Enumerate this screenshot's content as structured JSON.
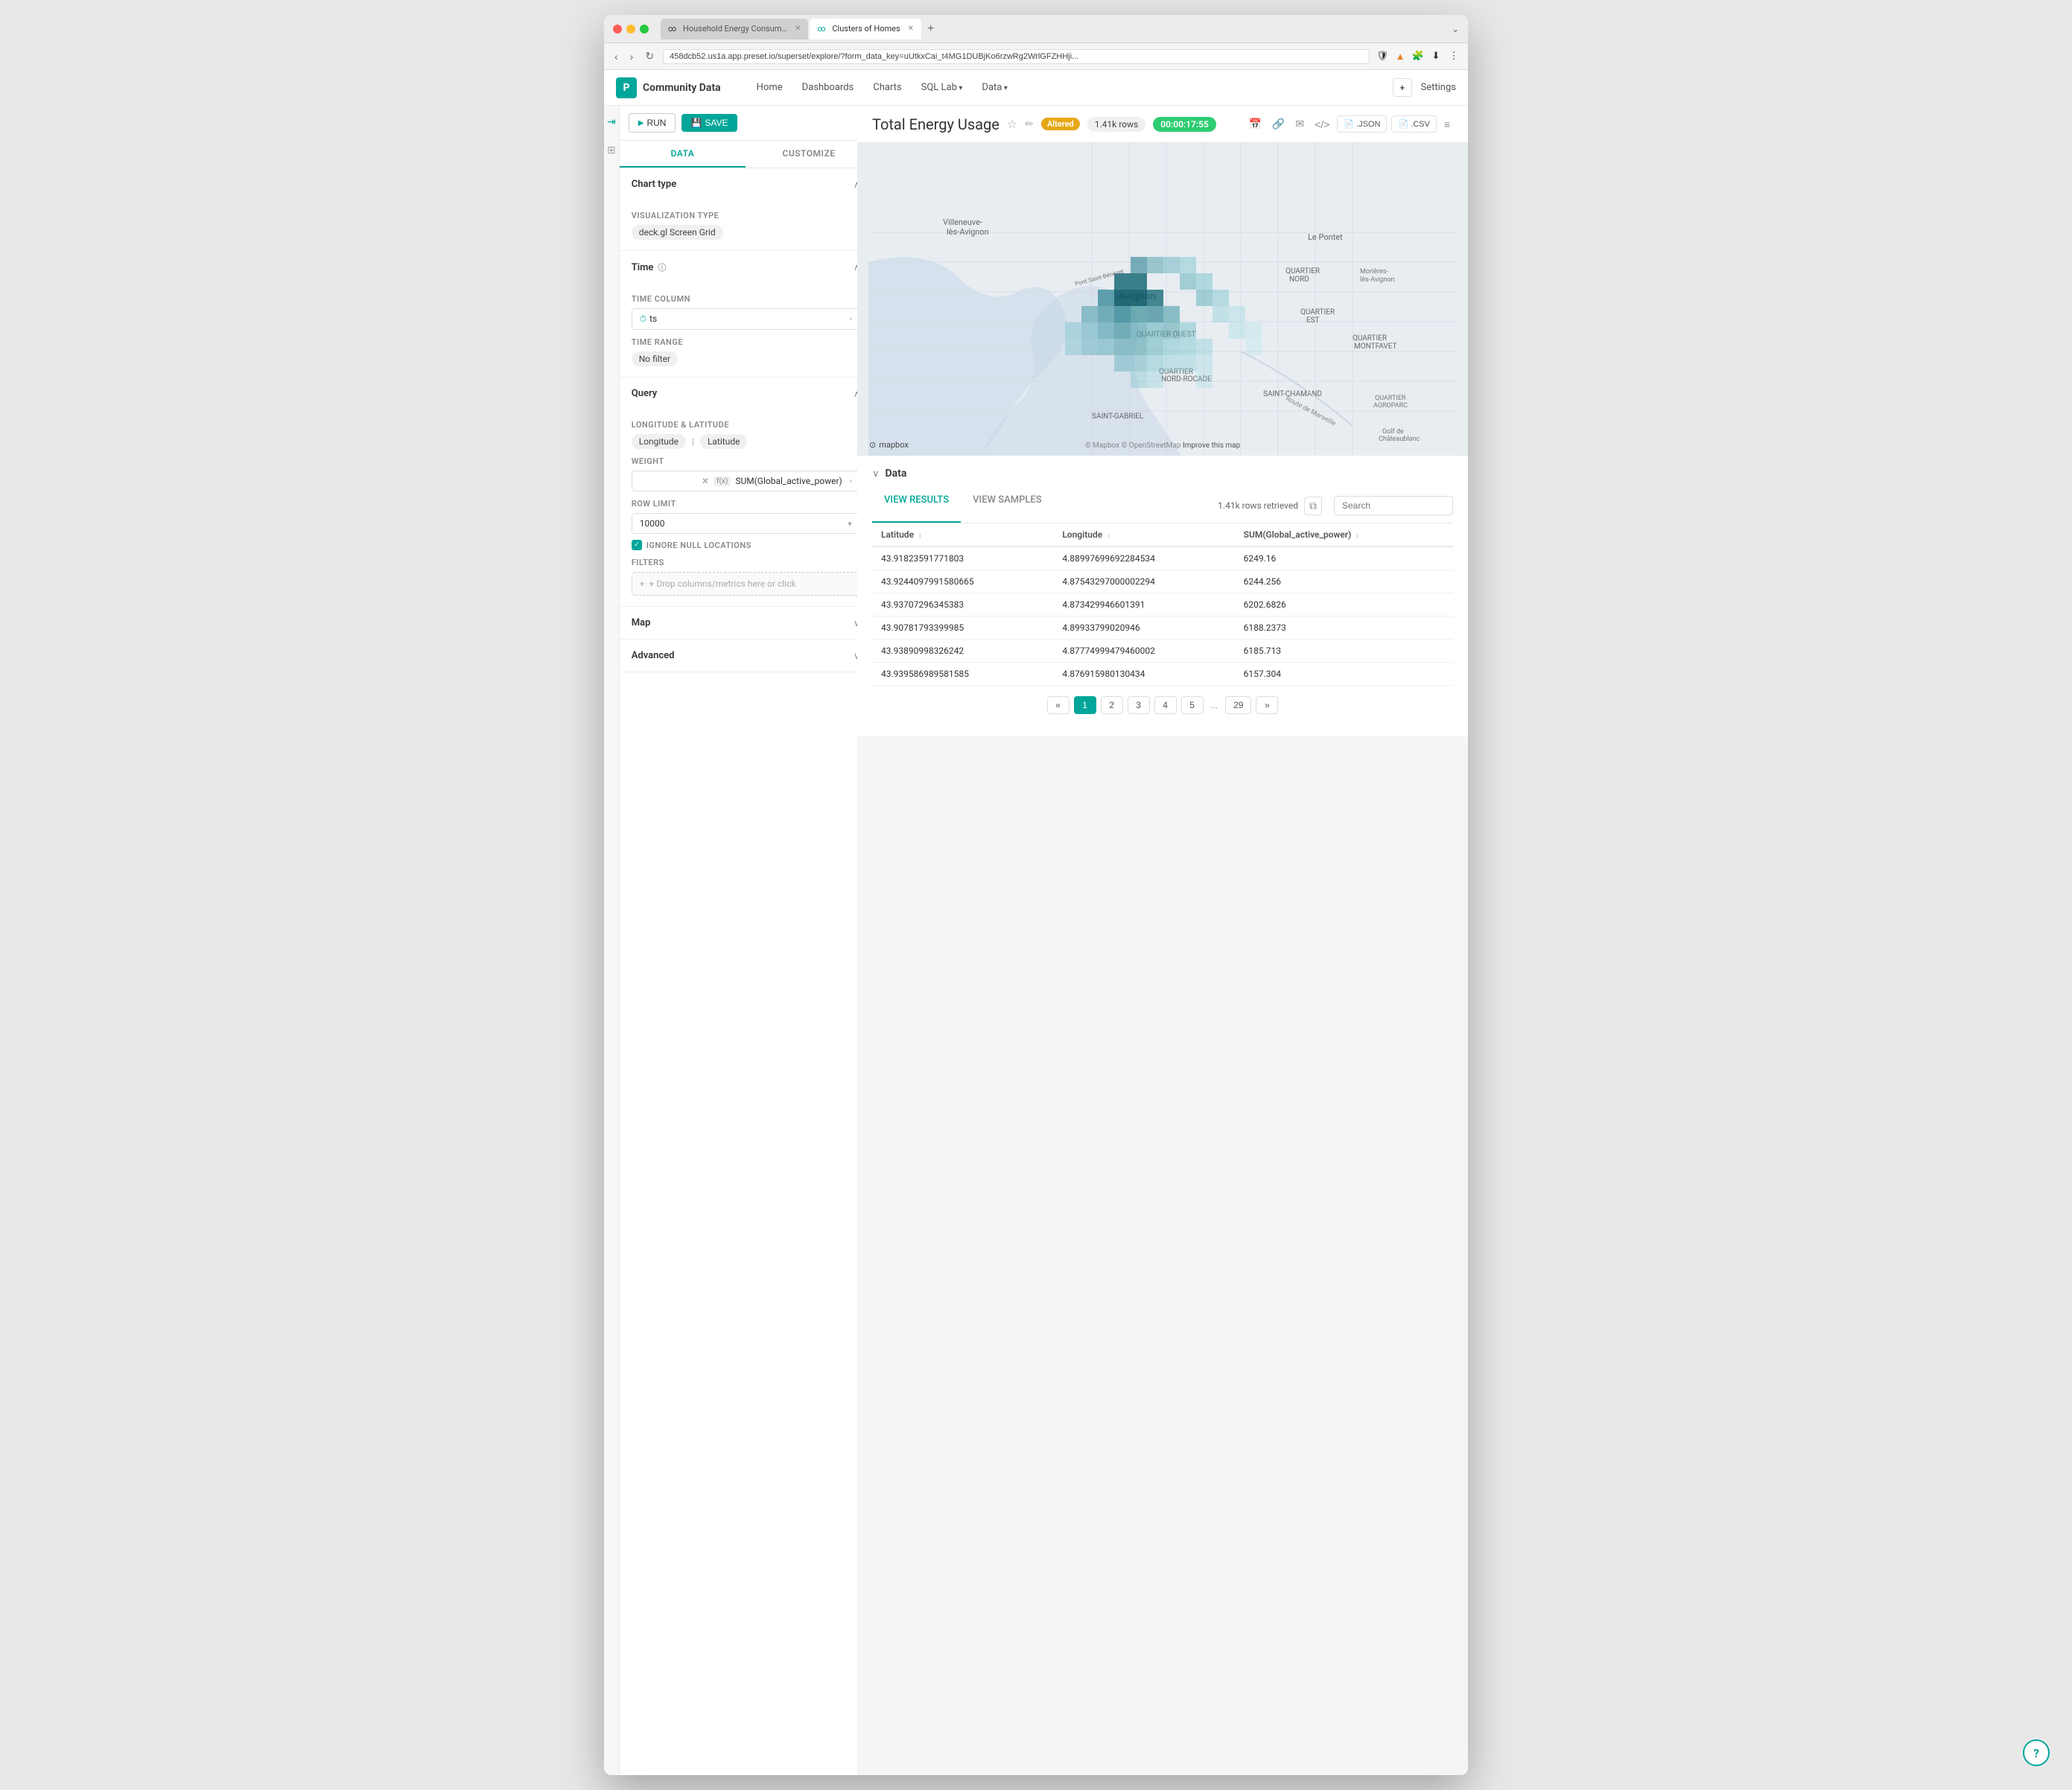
{
  "window": {
    "tabs": [
      {
        "id": "tab1",
        "label": "Household Energy Consumption (F...",
        "icon": "∞",
        "active": false
      },
      {
        "id": "tab2",
        "label": "Clusters of Homes",
        "icon": "∞",
        "active": true
      }
    ],
    "url": "458dcb52.us1a.app.preset.io/superset/explore/?form_data_key=uUtkxCai_t4MG1DUBjKo6rzwRg2WrlGFZHHji..."
  },
  "app": {
    "logo": "P",
    "title": "Community Data",
    "nav": [
      {
        "id": "home",
        "label": "Home"
      },
      {
        "id": "dashboards",
        "label": "Dashboards"
      },
      {
        "id": "charts",
        "label": "Charts"
      },
      {
        "id": "sql_lab",
        "label": "SQL Lab",
        "hasArrow": true
      },
      {
        "id": "data",
        "label": "Data",
        "hasArrow": true
      }
    ],
    "header_right": {
      "plus_label": "+",
      "settings_label": "Settings"
    }
  },
  "sidebar": {
    "run_label": "RUN",
    "save_label": "SAVE",
    "tabs": [
      {
        "id": "data",
        "label": "DATA",
        "active": true
      },
      {
        "id": "customize",
        "label": "CUSTOMIZE",
        "active": false
      }
    ],
    "chart_type": {
      "title": "Chart type",
      "viz_type_label": "VISUALIZATION TYPE",
      "viz_type_value": "deck.gl Screen Grid"
    },
    "time": {
      "title": "Time",
      "time_column_label": "TIME COLUMN",
      "time_column_value": "ts",
      "time_range_label": "TIME RANGE",
      "time_range_value": "No filter"
    },
    "query": {
      "title": "Query",
      "long_lat_label": "LONGITUDE & LATITUDE",
      "longitude": "Longitude",
      "latitude": "Latitude",
      "weight_label": "WEIGHT",
      "weight_value": "SUM(Global_active_power)",
      "row_limit_label": "ROW LIMIT",
      "row_limit_value": "10000",
      "ignore_null_label": "IGNORE NULL LOCATIONS",
      "filters_label": "FILTERS",
      "filters_placeholder": "+ Drop columns/metrics here or click"
    },
    "map": {
      "title": "Map"
    },
    "advanced": {
      "title": "Advanced"
    }
  },
  "chart": {
    "title": "Total Energy Usage",
    "altered_label": "Altered",
    "rows_label": "1.41k rows",
    "time_label": "00:00:17:55",
    "json_label": ".JSON",
    "csv_label": ".CSV"
  },
  "data_panel": {
    "title": "Data",
    "tabs": [
      {
        "id": "view_results",
        "label": "VIEW RESULTS",
        "active": true
      },
      {
        "id": "view_samples",
        "label": "VIEW SAMPLES",
        "active": false
      }
    ],
    "rows_retrieved": "1.41k rows retrieved",
    "search_placeholder": "Search",
    "columns": [
      {
        "id": "latitude",
        "label": "Latitude",
        "sort": "↕"
      },
      {
        "id": "longitude",
        "label": "Longitude",
        "sort": "↕"
      },
      {
        "id": "sum_gap",
        "label": "SUM(Global_active_power)",
        "sort": "↕"
      }
    ],
    "rows": [
      {
        "latitude": "43.91823591771803",
        "longitude": "4.88997699692284534",
        "sum": "6249.16"
      },
      {
        "latitude": "43.9244097991580665",
        "longitude": "4.87543297000002294",
        "sum": "6244.256"
      },
      {
        "latitude": "43.93707296345383",
        "longitude": "4.873429946601391",
        "sum": "6202.6826"
      },
      {
        "latitude": "43.90781793399985",
        "longitude": "4.89933799020946",
        "sum": "6188.2373"
      },
      {
        "latitude": "43.93890998326242",
        "longitude": "4.87774999479460002",
        "sum": "6185.713"
      },
      {
        "latitude": "43.939586989581585",
        "longitude": "4.876915980130434",
        "sum": "6157.304"
      }
    ],
    "pagination": {
      "prev": "«",
      "pages": [
        "1",
        "2",
        "3",
        "4",
        "5"
      ],
      "ellipsis": "...",
      "last": "29",
      "next": "»",
      "active_page": "1"
    }
  },
  "map": {
    "credit": "© Mapbox © OpenStreetMap",
    "improve_text": "Improve this map",
    "logo_text": "mapbox"
  }
}
